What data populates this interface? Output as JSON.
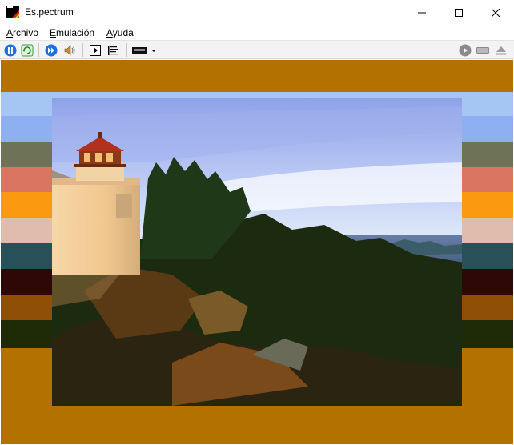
{
  "window": {
    "title": "Es.pectrum",
    "app_icon": "espectrum-rainbow-icon",
    "controls": [
      "minimize-icon",
      "maximize-icon",
      "close-icon"
    ]
  },
  "menu": {
    "items": [
      {
        "first": "A",
        "rest": "rchivo"
      },
      {
        "first": "E",
        "rest": "mulación"
      },
      {
        "first": "A",
        "rest": "yuda"
      }
    ]
  },
  "toolbar": {
    "left_icons": [
      "pause-icon",
      "reset-icon",
      "fast-forward-icon",
      "sound-icon",
      "tape-play-icon",
      "debugger-icon",
      "keyboard-dropdown-icon"
    ],
    "right_icons": [
      "tape-play-disabled-icon",
      "tape-stop-disabled-icon",
      "tape-eject-disabled-icon"
    ]
  },
  "emulator_screen": {
    "border_color": "#b37100",
    "border_bands": [
      "#a5c5f2",
      "#8fb0f0",
      "#6e7358",
      "#da7561",
      "#fb9a11",
      "#dfbcab",
      "#275059",
      "#2e0807",
      "#8f4f06",
      "#1f2a06",
      "#b37100"
    ],
    "image_subject": "lighthouse-on-cliff-at-sunset"
  }
}
